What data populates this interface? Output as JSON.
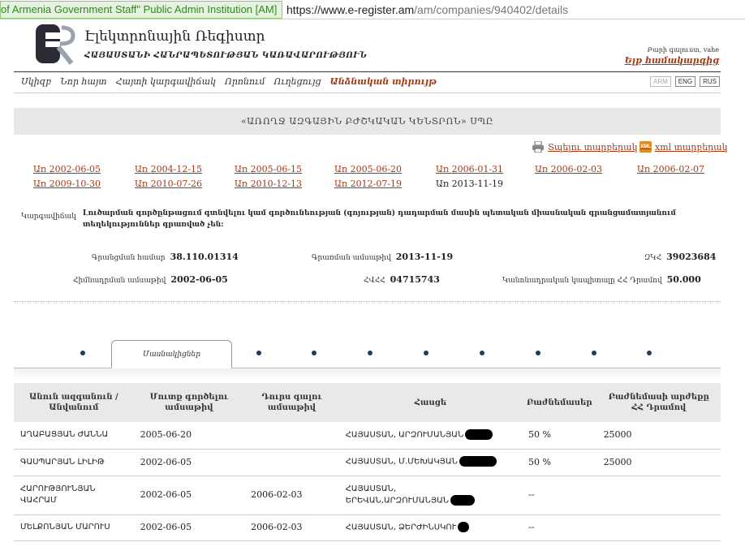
{
  "browser": {
    "ev_badge": "of Armenia Government Staff\"  Public Admin Institution [AM]",
    "url_host": "https://www.e-register.am",
    "url_path": "/am/companies/940402/details"
  },
  "header": {
    "site_title": "Էլեկտրոնային Ռեգիստր",
    "site_subtitle": "ՀԱՅԱՍՏԱՆԻ ՀԱՆՐԱՊԵՏՈՒԹՅԱՆ ԿԱՌԱՎԱՐՈՒԹՅՈՒՆ",
    "welcome": "Բարի գալուստ, vahe",
    "logout": "Ելք համակարգից"
  },
  "nav": {
    "items": [
      "Սկիզբ",
      "Նոր հայտ",
      "Հայտի կարգավիճակ",
      "Որոնում",
      "Ուղեցույց",
      "Անձնական տիրույթ"
    ],
    "langs": [
      "ARM",
      "ENG",
      "RUS"
    ]
  },
  "company": {
    "name": "«ԱՌՈՂՋ ԱԶԳԱՅԻՆ ԲԺՇԿԱԿԱՆ ԿԵՆՏՐՈՆ» ՍՊԸ"
  },
  "actions": {
    "print": "Տպելու տարբերակ",
    "xml": "xml տարբերակ",
    "xml_icon": "XML"
  },
  "dates": [
    "Առ 2002-06-05",
    "Առ 2004-12-15",
    "Առ 2005-06-15",
    "Առ 2005-06-20",
    "Առ 2006-01-31",
    "Առ 2006-02-03",
    "Առ 2006-02-07",
    "Առ 2009-10-30",
    "Առ 2010-07-26",
    "Առ 2010-12-13",
    "Առ 2012-07-19",
    "Առ 2013-11-19"
  ],
  "status": {
    "label": "Կարգավիճակ",
    "text": "Լուծարման գործընթացում գտնվելու կամ գործունեության (գոյության) դադարման մասին պետական միասնական գրանցամատյանում տեղեկություններ գրառված չեն:"
  },
  "info": {
    "reg_num_label": "Գրանցման համար",
    "reg_num": "38.110.01314",
    "reg_date_label": "Գրառման ամսաթիվ",
    "reg_date": "2013-11-19",
    "zkh_label": "ԶԿՀ",
    "zkh": "39023684",
    "found_label": "Հիմնադրման ամսաթիվ",
    "found_date": "2002-06-05",
    "hvhh_label": "ՀՎՀՀ",
    "hvhh": "04715743",
    "capital_label": "Կանոնադրական կապիտալը ՀՀ Դրամով",
    "capital": "50.000"
  },
  "tabs": {
    "active": "Մասնակիցներ"
  },
  "table": {
    "headers": [
      "Անուն ազգանուն / Անվանում",
      "Մուտք գործելու ամսաթիվ",
      "Դուրս գալու ամսաթիվ",
      "Հասցե",
      "Բաժնեմասեր",
      "Բաժնեմասի արժեքը ՀՀ Դրամով"
    ],
    "rows": [
      {
        "name": "ԱՂԱԲԱՑՅԱՆ ԺԱՆՆԱ",
        "in": "2005-06-20",
        "out": "",
        "addr": "ՀԱՅԱՍՏԱՆ, ԱՐԶՈՒՄԱՆՅԱՆ",
        "share": "50 %",
        "value": "25000"
      },
      {
        "name": "ԳԱՍՊԱՐՅԱՆ ԼԻԼԻԹ",
        "in": "2002-06-05",
        "out": "",
        "addr": "ՀԱՅԱՍՏԱՆ, Մ.ՄԵԽԱԿՅԱՆ",
        "share": "50 %",
        "value": "25000"
      },
      {
        "name": "ՀԱՐՈՒԹՅՈՒՆՅԱՆ ՎԱՀՐԱՄ",
        "in": "2002-06-05",
        "out": "2006-02-03",
        "addr1": "ՀԱՅԱՍՏԱՆ,",
        "addr2": "ԵՐԵՎԱՆ,ԱՐԶՈՒՄԱՆՅԱՆ",
        "share": "--",
        "value": ""
      },
      {
        "name": "ՄԵԼՔՈՆՅԱՆ ՄԱՐՈՒՍ",
        "in": "2002-06-05",
        "out": "2006-02-03",
        "addr": "ՀԱՅԱՍՏԱՆ, ՁԵՐԺԻՆՍԿՈՒ",
        "share": "--",
        "value": ""
      }
    ]
  },
  "colors": {
    "link": "#a23a18",
    "logo_dark": "#2b2b36",
    "accent_dot": "#23395b"
  }
}
